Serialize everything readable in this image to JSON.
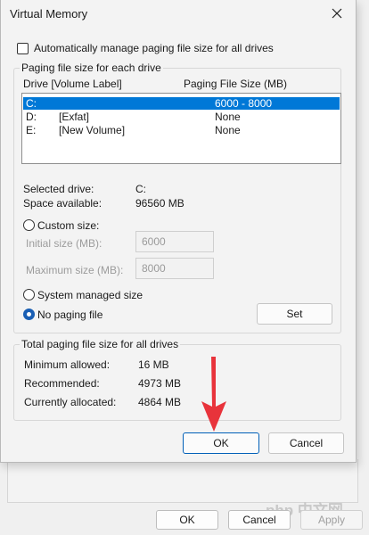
{
  "background_dialog": {
    "ok_label": "OK",
    "cancel_label": "Cancel",
    "apply_label": "Apply",
    "watermark": "php 中文网"
  },
  "dialog": {
    "title": "Virtual Memory",
    "close_icon": "close-icon",
    "auto_manage_label": "Automatically manage paging file size for all drives",
    "auto_manage_checked": false,
    "paging_group_label": "Paging file size for each drive",
    "drive_header": "Drive  [Volume Label]",
    "size_header": "Paging File Size (MB)",
    "drives": [
      {
        "drive": "C:",
        "label": "",
        "size": "6000 - 8000",
        "selected": true
      },
      {
        "drive": "D:",
        "label": "[Exfat]",
        "size": "None",
        "selected": false
      },
      {
        "drive": "E:",
        "label": "[New Volume]",
        "size": "None",
        "selected": false
      }
    ],
    "selected_drive_label": "Selected drive:",
    "selected_drive_value": "C:",
    "space_available_label": "Space available:",
    "space_available_value": "96560 MB",
    "custom_size_label": "Custom size:",
    "initial_size_label": "Initial size (MB):",
    "initial_size_value": "6000",
    "maximum_size_label": "Maximum size (MB):",
    "maximum_size_value": "8000",
    "system_managed_label": "System managed size",
    "no_paging_label": "No paging file",
    "selected_option": "no_paging",
    "set_label": "Set",
    "total_group_label": "Total paging file size for all drives",
    "min_allowed_label": "Minimum allowed:",
    "min_allowed_value": "16 MB",
    "recommended_label": "Recommended:",
    "recommended_value": "4973 MB",
    "currently_allocated_label": "Currently allocated:",
    "currently_allocated_value": "4864 MB",
    "ok_label": "OK",
    "cancel_label": "Cancel"
  },
  "colors": {
    "selection": "#0078d7",
    "accent": "#005fb8",
    "annotation_arrow": "#e8333b"
  }
}
